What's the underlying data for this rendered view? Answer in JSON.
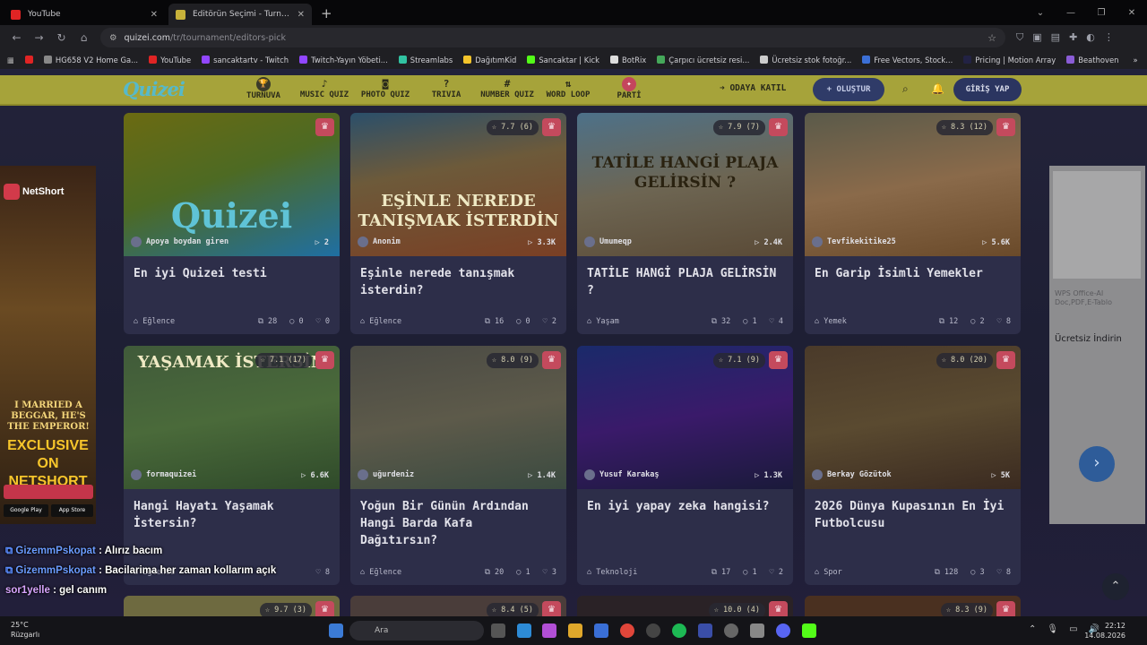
{
  "browser": {
    "tabs": [
      {
        "title": "YouTube",
        "active": false,
        "favicon_color": "#e02424"
      },
      {
        "title": "Editörün Seçimi - Turnuva - Quizei",
        "active": true,
        "favicon_color": "#c8b23a"
      }
    ],
    "new_tab": "+",
    "url_host": "quizei.com",
    "url_path": "/tr/tournament/editors-pick",
    "bookmarks": [
      {
        "label": "",
        "color": "#e02424"
      },
      {
        "label": "HG658 V2 Home Ga...",
        "color": "#888888"
      },
      {
        "label": "YouTube",
        "color": "#e02424"
      },
      {
        "label": "sancaktartv - Twitch",
        "color": "#9146ff"
      },
      {
        "label": "Twitch-Yayın Yöbeti...",
        "color": "#9146ff"
      },
      {
        "label": "Streamlabs",
        "color": "#31c3a2"
      },
      {
        "label": "DağıtımKid",
        "color": "#f3c42b"
      },
      {
        "label": "Sancaktar | Kick",
        "color": "#53fc18"
      },
      {
        "label": "BotRix",
        "color": "#dddddd"
      },
      {
        "label": "Çarpıcı ücretsiz resi...",
        "color": "#45a85a"
      },
      {
        "label": "Ücretsiz stok fotoğr...",
        "color": "#cccccc"
      },
      {
        "label": "Free Vectors, Stock...",
        "color": "#3b6fd6"
      },
      {
        "label": "Pricing | Motion Array",
        "color": "#222244"
      },
      {
        "label": "Beathoven",
        "color": "#8a5cd6"
      }
    ],
    "bookmarks_more": "»",
    "all_bookmarks": "Tüm Yer İşaretleri"
  },
  "site": {
    "logo": "Quizei",
    "nav": [
      {
        "label": "TURNUVA",
        "icon": "trophy-icon",
        "glyph": "🏆"
      },
      {
        "label": "MUSIC QUIZ",
        "icon": "music-icon",
        "glyph": "♪"
      },
      {
        "label": "PHOTO QUIZ",
        "icon": "camera-icon",
        "glyph": "◙"
      },
      {
        "label": "TRIVIA",
        "icon": "question-icon",
        "glyph": "?"
      },
      {
        "label": "NUMBER QUIZ",
        "icon": "hash-icon",
        "glyph": "#"
      },
      {
        "label": "WORD LOOP",
        "icon": "sort-icon",
        "glyph": "⇅"
      },
      {
        "label": "PARTİ",
        "icon": "party-icon",
        "glyph": "✦"
      }
    ],
    "join_room": "ODAYA KATIL",
    "create": "+ OLUŞTUR",
    "login": "GİRİŞ YAP"
  },
  "cards": [
    {
      "title": "En iyi Quizei testi",
      "author": "Apoya boydan giren",
      "plays": "2",
      "rating": "",
      "category": "Eğlence",
      "items": "28",
      "comments": "0",
      "likes": "0",
      "overlay": "Quizei",
      "bg": "linear-gradient(160deg,#6b6a12 0%,#4d6a23 45%,#1f6fa3 100%)"
    },
    {
      "title": "Eşinle nerede tanışmak isterdin?",
      "author": "Anonim",
      "plays": "3.3K",
      "rating": "7.7 (6)",
      "category": "Eğlence",
      "items": "16",
      "comments": "0",
      "likes": "2",
      "overlay": "EŞİNLE NEREDE TANIŞMAK İSTERDİN",
      "bg": "linear-gradient(170deg,#2b4f6a 0%,#6d5a3a 40%,#7a3f24 100%)"
    },
    {
      "title": "TATİLE HANGİ PLAJA GELİRSİN ?",
      "author": "Umumeqp",
      "plays": "2.4K",
      "rating": "7.9 (7)",
      "category": "Yaşam",
      "items": "32",
      "comments": "1",
      "likes": "4",
      "overlay": "TATİLE HANGİ PLAJA GELİRSİN ?",
      "bg": "linear-gradient(170deg,#4d7189 0%,#6d6552 50%,#5a4a36 100%)"
    },
    {
      "title": "En Garip İsimli Yemekler",
      "author": "Tevfikekitike25",
      "plays": "5.6K",
      "rating": "8.3 (12)",
      "category": "Yemek",
      "items": "12",
      "comments": "2",
      "likes": "8",
      "overlay": "",
      "bg": "linear-gradient(170deg,#5a5a4a 0%,#8a6a4a 50%,#6a4a2a 100%)"
    },
    {
      "title": "Hangi Hayatı Yaşamak İstersin?",
      "author": "formaquizei",
      "plays": "6.6K",
      "rating": "7.1 (17)",
      "category": "Eğlence",
      "items": "",
      "comments": "",
      "likes": "8",
      "overlay": "YAŞAMAK İSTERSİN",
      "bg": "linear-gradient(170deg,#405a3a 0%,#4a6a3a 50%,#2f4a2a 100%)"
    },
    {
      "title": "Yoğun Bir Günün Ardından Hangi Barda Kafa Dağıtırsın?",
      "author": "uğurdeniz",
      "plays": "1.4K",
      "rating": "8.0 (9)",
      "category": "Eğlence",
      "items": "20",
      "comments": "1",
      "likes": "3",
      "overlay": "",
      "bg": "linear-gradient(170deg,#4a4a44 0%,#5d5a4a 50%,#3a4a40 100%)"
    },
    {
      "title": "En iyi yapay zeka hangisi?",
      "author": "Yusuf Karakaş",
      "plays": "1.3K",
      "rating": "7.1 (9)",
      "category": "Teknoloji",
      "items": "17",
      "comments": "1",
      "likes": "2",
      "overlay": "",
      "bg": "linear-gradient(170deg,#1a2a6a 0%,#3a1a6a 50%,#1a1a3a 100%)"
    },
    {
      "title": "2026 Dünya Kupasının En İyi Futbolcusu",
      "author": "Berkay Gözütok",
      "plays": "5K",
      "rating": "8.0 (20)",
      "category": "Spor",
      "items": "128",
      "comments": "3",
      "likes": "8",
      "overlay": "",
      "bg": "linear-gradient(170deg,#4a3a2a 0%,#5a4a30 50%,#3a2a20 100%)"
    }
  ],
  "bottom_row_ratings": [
    "9.7 (3)",
    "8.4 (5)",
    "10.0 (4)",
    "8.3 (9)"
  ],
  "ads": {
    "left_brand": "NetShort",
    "left_slogan": "I MARRIED A BEGGAR, HE'S THE EMPEROR!",
    "left_cta": "EXCLUSIVE ON NETSHORT",
    "left_stores": [
      "Google Play",
      "App Store"
    ],
    "right_text1": "WPS Office-AI Doc,PDF,E-Tablo",
    "right_text2": "Ücretsiz İndirin"
  },
  "chat": [
    {
      "user": "GizemmPskopat",
      "msg": " : Alırız bacım",
      "color": "#6b9cff"
    },
    {
      "user": "GizemmPskopat",
      "msg": " : Bacilarima her zaman kollarım açık",
      "color": "#6b9cff"
    },
    {
      "user": "sor1yelle",
      "msg": " : gel canım",
      "color": "#d9a6ff"
    }
  ],
  "taskbar": {
    "temp": "25°C",
    "weather": "Rüzgarlı",
    "search": "Ara",
    "time": "22:12",
    "date": "14.08.2026"
  }
}
